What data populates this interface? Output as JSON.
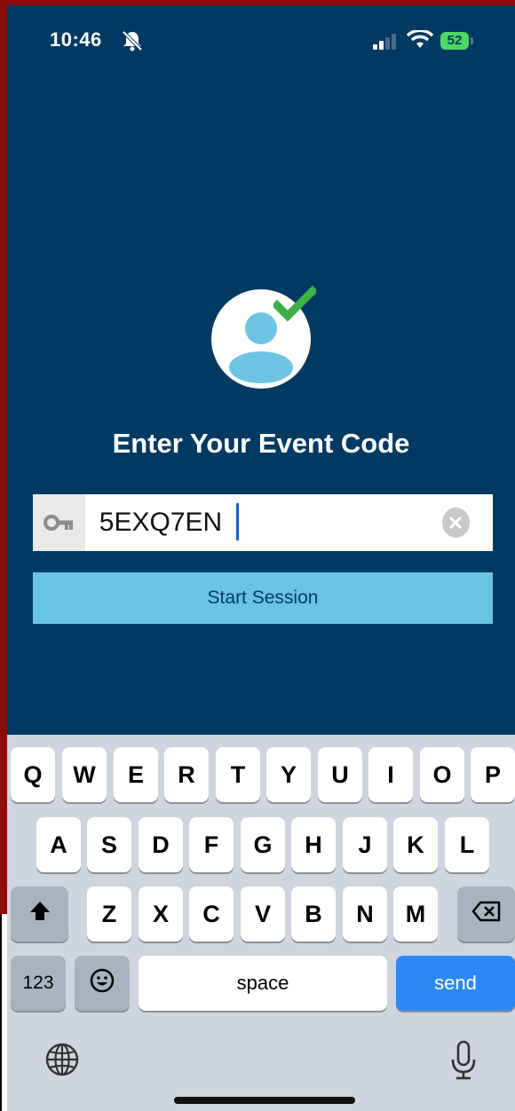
{
  "status_bar": {
    "time": "10:46",
    "battery": "52",
    "icons": [
      "bell-slash-icon",
      "signal-icon",
      "wifi-icon",
      "battery-icon"
    ]
  },
  "main": {
    "heading": "Enter Your Event Code",
    "code_value": "5EXQ7EN",
    "start_button": "Start Session",
    "icons": [
      "user-avatar-icon",
      "checkmark-icon",
      "key-icon",
      "clear-icon"
    ]
  },
  "colors": {
    "background": "#003a63",
    "button": "#69c4e4",
    "check": "#3cb043",
    "send": "#2c88f7"
  },
  "keyboard": {
    "row1": [
      "Q",
      "W",
      "E",
      "R",
      "T",
      "Y",
      "U",
      "I",
      "O",
      "P"
    ],
    "row2": [
      "A",
      "S",
      "D",
      "F",
      "G",
      "H",
      "J",
      "K",
      "L"
    ],
    "row3": [
      "Z",
      "X",
      "C",
      "V",
      "B",
      "N",
      "M"
    ],
    "numbers_label": "123",
    "space_label": "space",
    "send_label": "send",
    "icons": [
      "shift-icon",
      "backspace-icon",
      "emoji-icon",
      "globe-icon",
      "microphone-icon"
    ]
  }
}
